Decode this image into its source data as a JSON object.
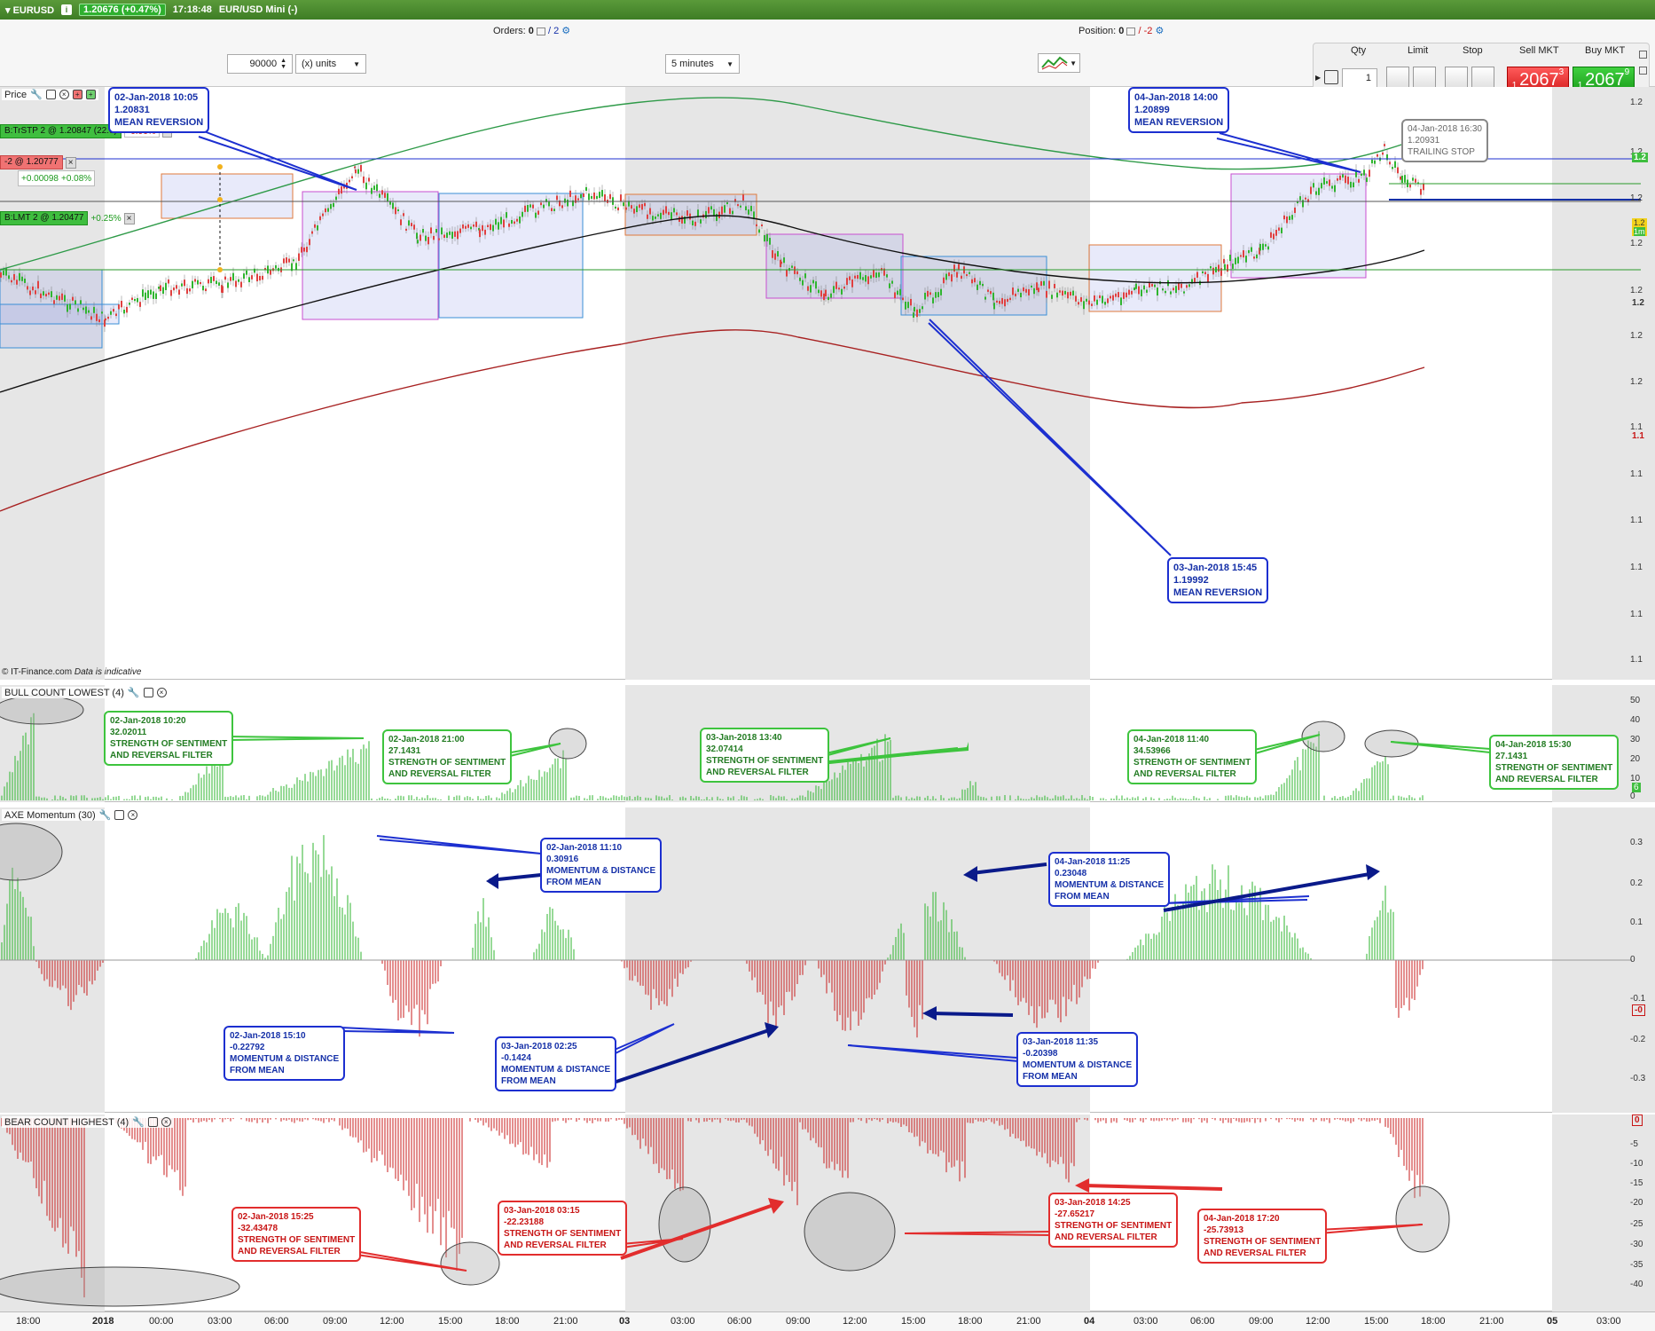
{
  "titlebar": {
    "instrument": "EURUSD",
    "change": "1.20676 (+0.47%)",
    "time": "17:18:48",
    "description": "EUR/USD Mini (-)"
  },
  "toolbar": {
    "orders_label": "Orders:",
    "orders_value": "0",
    "orders_total": "/ 2",
    "position_label": "Position:",
    "position_value": "0",
    "position_total": "/ -2",
    "quantity_value": "90000",
    "units_select": "(x) units",
    "timeframe_select": "5 minutes",
    "qty_header": "Qty",
    "qty_value": "1",
    "limit_header": "Limit",
    "stop_header": "Stop",
    "sell_header": "Sell MKT",
    "buy_header": "Buy MKT",
    "sell_prefix": "1.",
    "sell_price": "2067",
    "sell_suffix": "3",
    "buy_prefix": "1.",
    "buy_price": "2067",
    "buy_suffix": "9"
  },
  "price_pane": {
    "label": "Price",
    "watermark_prefix": "© IT-Finance.com",
    "watermark_note": "Data is indicative",
    "orders": {
      "trailing_stop": "B:TrSTP 2 @ 1.20847 (22.0)",
      "trailing_pct": "-0.06%",
      "position": "-2 @ 1.20777",
      "position_pl": "+0.00098",
      "position_pl_pct": "+0.08%",
      "limit": "B:LMT 2 @ 1.20477",
      "limit_pct": "+0.25%"
    },
    "annotations": [
      {
        "date": "02-Jan-2018 10:05",
        "value": "1.20831",
        "label": "MEAN REVERSION"
      },
      {
        "date": "04-Jan-2018 14:00",
        "value": "1.20899",
        "label": "MEAN REVERSION"
      },
      {
        "date": "03-Jan-2018 15:45",
        "value": "1.19992",
        "label": "MEAN REVERSION"
      },
      {
        "date": "04-Jan-2018 16:30",
        "value": "1.20931",
        "label": "TRAILING STOP"
      }
    ],
    "axis_labels": [
      "1.2",
      "1.2",
      "1.2",
      "1.2",
      "1.2",
      "1.2",
      "1.2",
      "1.1",
      "1.1",
      "1.1",
      "1.1",
      "1.1",
      "1.1"
    ],
    "axis_tags": {
      "green_top": "1.2",
      "yellow": "1.2",
      "yellow_sub": "1m",
      "black": "1.2",
      "red": "1.1"
    }
  },
  "bull_pane": {
    "label": "BULL COUNT LOWEST (4)",
    "axis_labels": [
      "50",
      "40",
      "30",
      "20",
      "10",
      "0"
    ],
    "axis_tag": "6",
    "annotations": [
      {
        "date": "02-Jan-2018 10:20",
        "value": "32.02011",
        "label1": "STRENGTH OF SENTIMENT",
        "label2": "AND REVERSAL FILTER"
      },
      {
        "date": "02-Jan-2018 21:00",
        "value": "27.1431",
        "label1": "STRENGTH OF SENTIMENT",
        "label2": "AND REVERSAL FILTER"
      },
      {
        "date": "03-Jan-2018 13:40",
        "value": "32.07414",
        "label1": "STRENGTH OF SENTIMENT",
        "label2": "AND REVERSAL FILTER"
      },
      {
        "date": "04-Jan-2018 11:40",
        "value": "34.53966",
        "label1": "STRENGTH OF SENTIMENT",
        "label2": "AND REVERSAL FILTER"
      },
      {
        "date": "04-Jan-2018 15:30",
        "value": "27.1431",
        "label1": "STRENGTH OF SENTIMENT",
        "label2": "AND REVERSAL FILTER"
      }
    ]
  },
  "axe_pane": {
    "label": "AXE Momentum (30)",
    "axis_labels": [
      "0.3",
      "0.2",
      "0.1",
      "0",
      "-0.1",
      "-0.2",
      "-0.3"
    ],
    "axis_tag": "-0",
    "annotations": [
      {
        "date": "02-Jan-2018 11:10",
        "value": "0.30916",
        "label1": "MOMENTUM & DISTANCE",
        "label2": "FROM MEAN"
      },
      {
        "date": "04-Jan-2018 11:25",
        "value": "0.23048",
        "label1": "MOMENTUM & DISTANCE",
        "label2": "FROM MEAN"
      },
      {
        "date": "02-Jan-2018 15:10",
        "value": "-0.22792",
        "label1": "MOMENTUM & DISTANCE",
        "label2": "FROM MEAN"
      },
      {
        "date": "03-Jan-2018 02:25",
        "value": "-0.1424",
        "label1": "MOMENTUM & DISTANCE",
        "label2": "FROM MEAN"
      },
      {
        "date": "03-Jan-2018 11:35",
        "value": "-0.20398",
        "label1": "MOMENTUM & DISTANCE",
        "label2": "FROM MEAN"
      }
    ]
  },
  "bear_pane": {
    "label": "BEAR COUNT HIGHEST (4)",
    "axis_labels": [
      "-5",
      "-10",
      "-15",
      "-20",
      "-25",
      "-30",
      "-35",
      "-40"
    ],
    "axis_tag": "0",
    "annotations": [
      {
        "date": "02-Jan-2018 15:25",
        "value": "-32.43478",
        "label1": "STRENGTH OF SENTIMENT",
        "label2": "AND REVERSAL FILTER"
      },
      {
        "date": "03-Jan-2018 03:15",
        "value": "-22.23188",
        "label1": "STRENGTH OF SENTIMENT",
        "label2": "AND REVERSAL FILTER"
      },
      {
        "date": "03-Jan-2018 14:25",
        "value": "-27.65217",
        "label1": "STRENGTH OF SENTIMENT",
        "label2": "AND REVERSAL FILTER"
      },
      {
        "date": "04-Jan-2018 17:20",
        "value": "-25.73913",
        "label1": "STRENGTH OF SENTIMENT",
        "label2": "AND REVERSAL FILTER"
      }
    ]
  },
  "x_axis": [
    "18:00",
    "2018",
    "00:00",
    "03:00",
    "06:00",
    "09:00",
    "12:00",
    "15:00",
    "18:00",
    "21:00",
    "03",
    "03:00",
    "06:00",
    "09:00",
    "12:00",
    "15:00",
    "18:00",
    "21:00",
    "04",
    "03:00",
    "06:00",
    "09:00",
    "12:00",
    "15:00",
    "18:00",
    "21:00",
    "05",
    "03:00"
  ],
  "colors": {
    "bull": "#2fb52f",
    "bear": "#c81e1e",
    "annotation_blue": "#1c2fd0",
    "title_green": "#4a8c2e"
  }
}
